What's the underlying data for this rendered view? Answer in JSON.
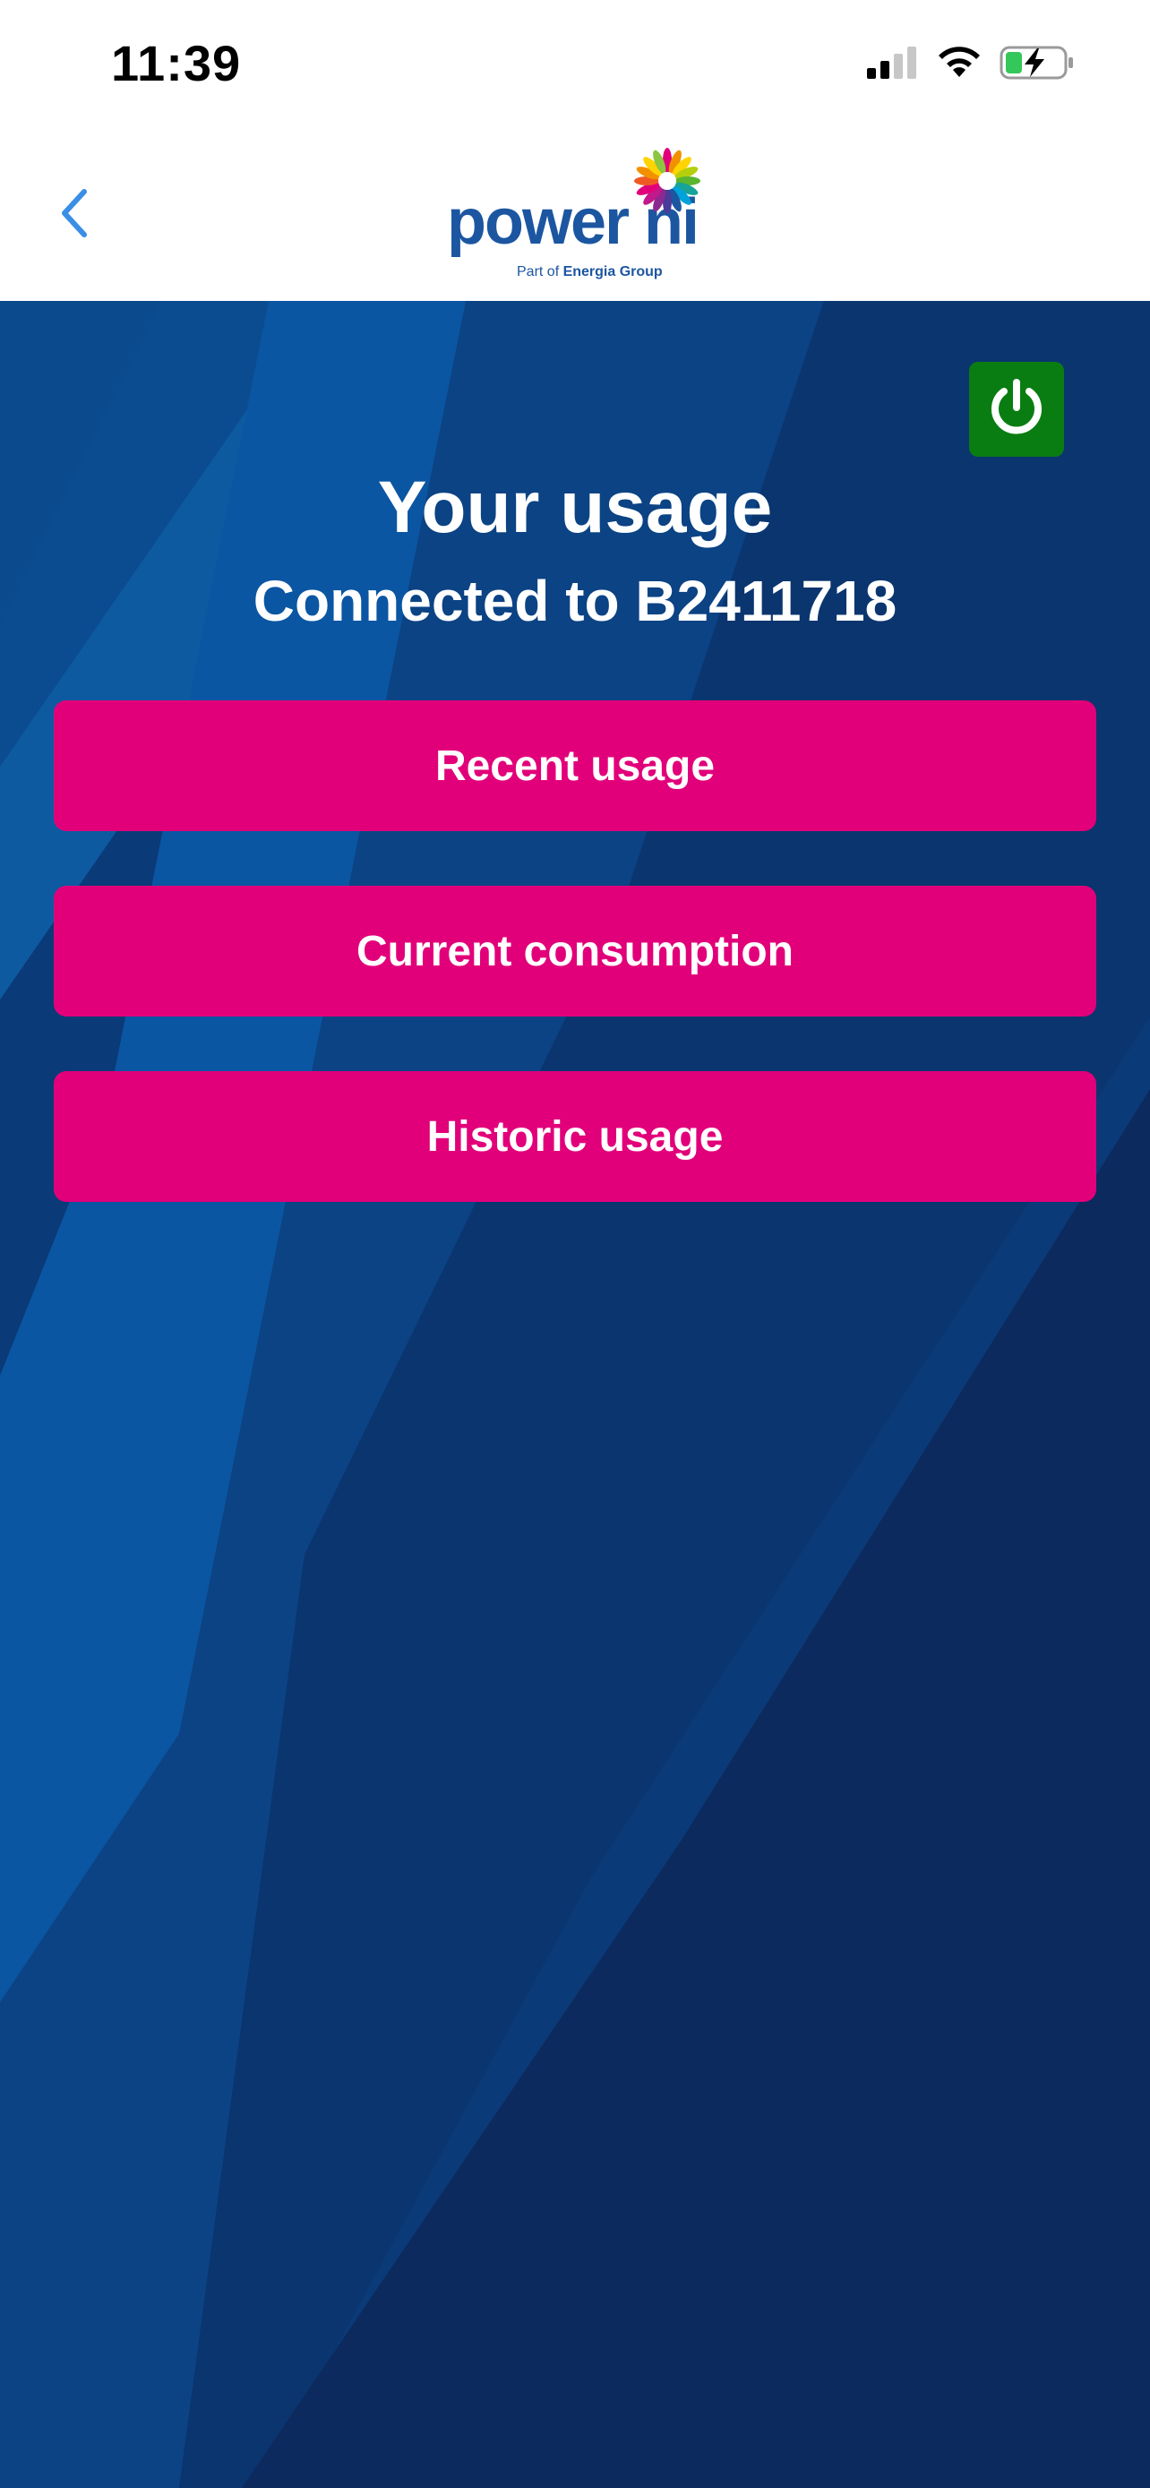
{
  "status_bar": {
    "time": "11:39",
    "icons": [
      "cellular-signal-icon",
      "wifi-icon",
      "battery-charging-icon"
    ]
  },
  "header": {
    "back_icon": "chevron-left-icon",
    "logo": {
      "wordmark": "power ni",
      "tagline_prefix": "Part of ",
      "tagline_brand": "Energia Group"
    }
  },
  "main": {
    "title": "Your usage",
    "subtitle": "Connected to B2411718",
    "power_icon": "power-icon",
    "buttons": [
      {
        "label": "Recent usage"
      },
      {
        "label": "Current consumption"
      },
      {
        "label": "Historic usage"
      }
    ]
  },
  "colors": {
    "brand_blue": "#1c56a1",
    "background_blue": "#0a3570",
    "button_magenta": "#e2007a",
    "power_green": "#0a7d12",
    "back_blue": "#3a8ee6"
  }
}
